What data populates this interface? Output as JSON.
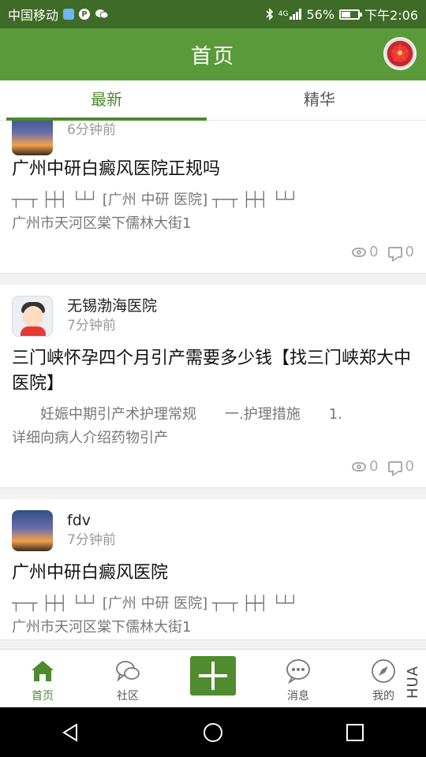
{
  "status_bar": {
    "carrier": "中国移动",
    "network": "4G",
    "battery": "56%",
    "battery_level": 0.56,
    "time": "下午2:06"
  },
  "header": {
    "title": "首页"
  },
  "tabs": [
    {
      "label": "最新",
      "active": true
    },
    {
      "label": "精华",
      "active": false
    }
  ],
  "posts": [
    {
      "time": "6分钟前",
      "title": "广州中研白癜风医院正规吗",
      "excerpt": [
        "┬─┬  ├┼┤  └┴┘ [广州 中研 医院] ┬─┬  ├┼┤  └┴┘",
        "广州市天河区棠下儒林大街1"
      ],
      "views": "0",
      "comments": "0"
    },
    {
      "username": "无锡渤海医院",
      "time": "7分钟前",
      "title": "三门峡怀孕四个月引产需要多少钱【找三门峡郑大中医院】",
      "excerpt": [
        "　　妊娠中期引产术护理常规　　一.护理措施　　1.",
        "详细向病人介绍药物引产"
      ],
      "views": "0",
      "comments": "0"
    },
    {
      "username": "fdv",
      "time": "7分钟前",
      "title": "广州中研白癜风医院",
      "excerpt": [
        "┬─┬  ├┼┤  └┴┘ [广州 中研 医院] ┬─┬  ├┼┤  └┴┘",
        "广州市天河区棠下儒林大街1"
      ]
    }
  ],
  "bottom_nav": [
    {
      "label": "首页",
      "icon": "home-icon",
      "active": true
    },
    {
      "label": "社区",
      "icon": "community-icon",
      "active": false
    },
    {
      "label": "",
      "icon": "plus-icon",
      "active": false
    },
    {
      "label": "消息",
      "icon": "message-icon",
      "active": false
    },
    {
      "label": "我的",
      "icon": "compass-icon",
      "active": false
    }
  ],
  "edge_text": "HUA",
  "colors": {
    "primary": "#5b9a3b",
    "dark_primary": "#3f6b28",
    "accent": "#4e8a2e"
  }
}
